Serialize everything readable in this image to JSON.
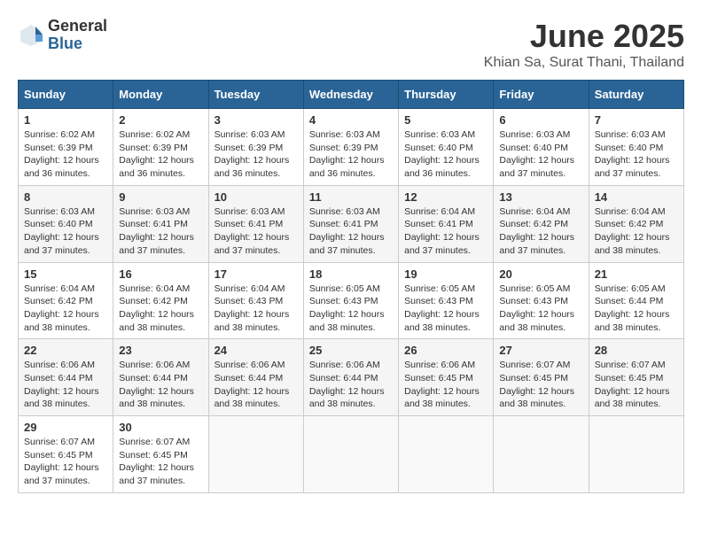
{
  "header": {
    "logo_general": "General",
    "logo_blue": "Blue",
    "month": "June 2025",
    "location": "Khian Sa, Surat Thani, Thailand"
  },
  "weekdays": [
    "Sunday",
    "Monday",
    "Tuesday",
    "Wednesday",
    "Thursday",
    "Friday",
    "Saturday"
  ],
  "weeks": [
    [
      {
        "day": "1",
        "sunrise": "6:02 AM",
        "sunset": "6:39 PM",
        "daylight": "12 hours and 36 minutes."
      },
      {
        "day": "2",
        "sunrise": "6:02 AM",
        "sunset": "6:39 PM",
        "daylight": "12 hours and 36 minutes."
      },
      {
        "day": "3",
        "sunrise": "6:03 AM",
        "sunset": "6:39 PM",
        "daylight": "12 hours and 36 minutes."
      },
      {
        "day": "4",
        "sunrise": "6:03 AM",
        "sunset": "6:39 PM",
        "daylight": "12 hours and 36 minutes."
      },
      {
        "day": "5",
        "sunrise": "6:03 AM",
        "sunset": "6:40 PM",
        "daylight": "12 hours and 36 minutes."
      },
      {
        "day": "6",
        "sunrise": "6:03 AM",
        "sunset": "6:40 PM",
        "daylight": "12 hours and 37 minutes."
      },
      {
        "day": "7",
        "sunrise": "6:03 AM",
        "sunset": "6:40 PM",
        "daylight": "12 hours and 37 minutes."
      }
    ],
    [
      {
        "day": "8",
        "sunrise": "6:03 AM",
        "sunset": "6:40 PM",
        "daylight": "12 hours and 37 minutes."
      },
      {
        "day": "9",
        "sunrise": "6:03 AM",
        "sunset": "6:41 PM",
        "daylight": "12 hours and 37 minutes."
      },
      {
        "day": "10",
        "sunrise": "6:03 AM",
        "sunset": "6:41 PM",
        "daylight": "12 hours and 37 minutes."
      },
      {
        "day": "11",
        "sunrise": "6:03 AM",
        "sunset": "6:41 PM",
        "daylight": "12 hours and 37 minutes."
      },
      {
        "day": "12",
        "sunrise": "6:04 AM",
        "sunset": "6:41 PM",
        "daylight": "12 hours and 37 minutes."
      },
      {
        "day": "13",
        "sunrise": "6:04 AM",
        "sunset": "6:42 PM",
        "daylight": "12 hours and 37 minutes."
      },
      {
        "day": "14",
        "sunrise": "6:04 AM",
        "sunset": "6:42 PM",
        "daylight": "12 hours and 38 minutes."
      }
    ],
    [
      {
        "day": "15",
        "sunrise": "6:04 AM",
        "sunset": "6:42 PM",
        "daylight": "12 hours and 38 minutes."
      },
      {
        "day": "16",
        "sunrise": "6:04 AM",
        "sunset": "6:42 PM",
        "daylight": "12 hours and 38 minutes."
      },
      {
        "day": "17",
        "sunrise": "6:04 AM",
        "sunset": "6:43 PM",
        "daylight": "12 hours and 38 minutes."
      },
      {
        "day": "18",
        "sunrise": "6:05 AM",
        "sunset": "6:43 PM",
        "daylight": "12 hours and 38 minutes."
      },
      {
        "day": "19",
        "sunrise": "6:05 AM",
        "sunset": "6:43 PM",
        "daylight": "12 hours and 38 minutes."
      },
      {
        "day": "20",
        "sunrise": "6:05 AM",
        "sunset": "6:43 PM",
        "daylight": "12 hours and 38 minutes."
      },
      {
        "day": "21",
        "sunrise": "6:05 AM",
        "sunset": "6:44 PM",
        "daylight": "12 hours and 38 minutes."
      }
    ],
    [
      {
        "day": "22",
        "sunrise": "6:06 AM",
        "sunset": "6:44 PM",
        "daylight": "12 hours and 38 minutes."
      },
      {
        "day": "23",
        "sunrise": "6:06 AM",
        "sunset": "6:44 PM",
        "daylight": "12 hours and 38 minutes."
      },
      {
        "day": "24",
        "sunrise": "6:06 AM",
        "sunset": "6:44 PM",
        "daylight": "12 hours and 38 minutes."
      },
      {
        "day": "25",
        "sunrise": "6:06 AM",
        "sunset": "6:44 PM",
        "daylight": "12 hours and 38 minutes."
      },
      {
        "day": "26",
        "sunrise": "6:06 AM",
        "sunset": "6:45 PM",
        "daylight": "12 hours and 38 minutes."
      },
      {
        "day": "27",
        "sunrise": "6:07 AM",
        "sunset": "6:45 PM",
        "daylight": "12 hours and 38 minutes."
      },
      {
        "day": "28",
        "sunrise": "6:07 AM",
        "sunset": "6:45 PM",
        "daylight": "12 hours and 38 minutes."
      }
    ],
    [
      {
        "day": "29",
        "sunrise": "6:07 AM",
        "sunset": "6:45 PM",
        "daylight": "12 hours and 37 minutes."
      },
      {
        "day": "30",
        "sunrise": "6:07 AM",
        "sunset": "6:45 PM",
        "daylight": "12 hours and 37 minutes."
      },
      null,
      null,
      null,
      null,
      null
    ]
  ]
}
